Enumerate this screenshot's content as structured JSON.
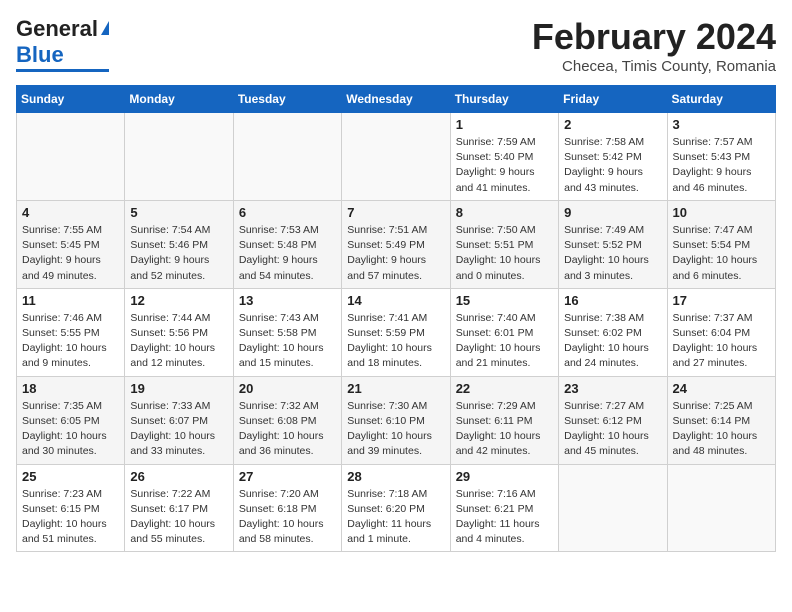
{
  "header": {
    "logo_line1": "General",
    "logo_line2": "Blue",
    "title": "February 2024",
    "subtitle": "Checea, Timis County, Romania"
  },
  "columns": [
    "Sunday",
    "Monday",
    "Tuesday",
    "Wednesday",
    "Thursday",
    "Friday",
    "Saturday"
  ],
  "weeks": [
    {
      "days": [
        {
          "num": "",
          "info": ""
        },
        {
          "num": "",
          "info": ""
        },
        {
          "num": "",
          "info": ""
        },
        {
          "num": "",
          "info": ""
        },
        {
          "num": "1",
          "info": "Sunrise: 7:59 AM\nSunset: 5:40 PM\nDaylight: 9 hours\nand 41 minutes."
        },
        {
          "num": "2",
          "info": "Sunrise: 7:58 AM\nSunset: 5:42 PM\nDaylight: 9 hours\nand 43 minutes."
        },
        {
          "num": "3",
          "info": "Sunrise: 7:57 AM\nSunset: 5:43 PM\nDaylight: 9 hours\nand 46 minutes."
        }
      ]
    },
    {
      "days": [
        {
          "num": "4",
          "info": "Sunrise: 7:55 AM\nSunset: 5:45 PM\nDaylight: 9 hours\nand 49 minutes."
        },
        {
          "num": "5",
          "info": "Sunrise: 7:54 AM\nSunset: 5:46 PM\nDaylight: 9 hours\nand 52 minutes."
        },
        {
          "num": "6",
          "info": "Sunrise: 7:53 AM\nSunset: 5:48 PM\nDaylight: 9 hours\nand 54 minutes."
        },
        {
          "num": "7",
          "info": "Sunrise: 7:51 AM\nSunset: 5:49 PM\nDaylight: 9 hours\nand 57 minutes."
        },
        {
          "num": "8",
          "info": "Sunrise: 7:50 AM\nSunset: 5:51 PM\nDaylight: 10 hours\nand 0 minutes."
        },
        {
          "num": "9",
          "info": "Sunrise: 7:49 AM\nSunset: 5:52 PM\nDaylight: 10 hours\nand 3 minutes."
        },
        {
          "num": "10",
          "info": "Sunrise: 7:47 AM\nSunset: 5:54 PM\nDaylight: 10 hours\nand 6 minutes."
        }
      ]
    },
    {
      "days": [
        {
          "num": "11",
          "info": "Sunrise: 7:46 AM\nSunset: 5:55 PM\nDaylight: 10 hours\nand 9 minutes."
        },
        {
          "num": "12",
          "info": "Sunrise: 7:44 AM\nSunset: 5:56 PM\nDaylight: 10 hours\nand 12 minutes."
        },
        {
          "num": "13",
          "info": "Sunrise: 7:43 AM\nSunset: 5:58 PM\nDaylight: 10 hours\nand 15 minutes."
        },
        {
          "num": "14",
          "info": "Sunrise: 7:41 AM\nSunset: 5:59 PM\nDaylight: 10 hours\nand 18 minutes."
        },
        {
          "num": "15",
          "info": "Sunrise: 7:40 AM\nSunset: 6:01 PM\nDaylight: 10 hours\nand 21 minutes."
        },
        {
          "num": "16",
          "info": "Sunrise: 7:38 AM\nSunset: 6:02 PM\nDaylight: 10 hours\nand 24 minutes."
        },
        {
          "num": "17",
          "info": "Sunrise: 7:37 AM\nSunset: 6:04 PM\nDaylight: 10 hours\nand 27 minutes."
        }
      ]
    },
    {
      "days": [
        {
          "num": "18",
          "info": "Sunrise: 7:35 AM\nSunset: 6:05 PM\nDaylight: 10 hours\nand 30 minutes."
        },
        {
          "num": "19",
          "info": "Sunrise: 7:33 AM\nSunset: 6:07 PM\nDaylight: 10 hours\nand 33 minutes."
        },
        {
          "num": "20",
          "info": "Sunrise: 7:32 AM\nSunset: 6:08 PM\nDaylight: 10 hours\nand 36 minutes."
        },
        {
          "num": "21",
          "info": "Sunrise: 7:30 AM\nSunset: 6:10 PM\nDaylight: 10 hours\nand 39 minutes."
        },
        {
          "num": "22",
          "info": "Sunrise: 7:29 AM\nSunset: 6:11 PM\nDaylight: 10 hours\nand 42 minutes."
        },
        {
          "num": "23",
          "info": "Sunrise: 7:27 AM\nSunset: 6:12 PM\nDaylight: 10 hours\nand 45 minutes."
        },
        {
          "num": "24",
          "info": "Sunrise: 7:25 AM\nSunset: 6:14 PM\nDaylight: 10 hours\nand 48 minutes."
        }
      ]
    },
    {
      "days": [
        {
          "num": "25",
          "info": "Sunrise: 7:23 AM\nSunset: 6:15 PM\nDaylight: 10 hours\nand 51 minutes."
        },
        {
          "num": "26",
          "info": "Sunrise: 7:22 AM\nSunset: 6:17 PM\nDaylight: 10 hours\nand 55 minutes."
        },
        {
          "num": "27",
          "info": "Sunrise: 7:20 AM\nSunset: 6:18 PM\nDaylight: 10 hours\nand 58 minutes."
        },
        {
          "num": "28",
          "info": "Sunrise: 7:18 AM\nSunset: 6:20 PM\nDaylight: 11 hours\nand 1 minute."
        },
        {
          "num": "29",
          "info": "Sunrise: 7:16 AM\nSunset: 6:21 PM\nDaylight: 11 hours\nand 4 minutes."
        },
        {
          "num": "",
          "info": ""
        },
        {
          "num": "",
          "info": ""
        }
      ]
    }
  ]
}
